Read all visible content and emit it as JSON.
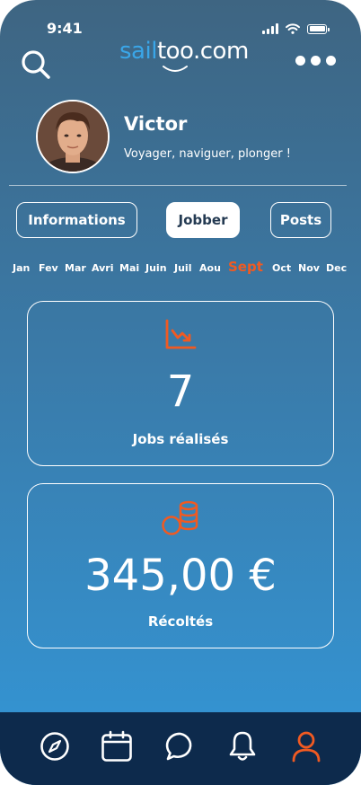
{
  "status_bar": {
    "time": "9:41"
  },
  "header": {
    "logo_sail": "sail",
    "logo_too": "too",
    "logo_com": ".com"
  },
  "profile": {
    "name": "Victor",
    "bio": "Voyager, naviguer, plonger !"
  },
  "tabs": [
    {
      "label": "Informations",
      "active": false
    },
    {
      "label": "Jobber",
      "active": true
    },
    {
      "label": "Posts",
      "active": false
    }
  ],
  "months": [
    "Jan",
    "Fev",
    "Mar",
    "Avri",
    "Mai",
    "Juin",
    "Juil",
    "Aou",
    "Sept",
    "Oct",
    "Nov",
    "Dec"
  ],
  "selected_month": "Sept",
  "stats": {
    "jobs_count": "7",
    "jobs_label": "Jobs réalisés",
    "earnings": "345,00 €",
    "earnings_label": "Récoltés"
  },
  "colors": {
    "accent": "#f05a22",
    "brand_blue": "#3aa6e8",
    "nav_background": "#0d2a4c"
  },
  "icons": {
    "search": "search-icon",
    "more": "more-icon",
    "chart": "chart-down-icon",
    "coins": "coins-icon",
    "nav": [
      "compass-icon",
      "calendar-icon",
      "chat-icon",
      "bell-icon",
      "user-icon"
    ]
  }
}
